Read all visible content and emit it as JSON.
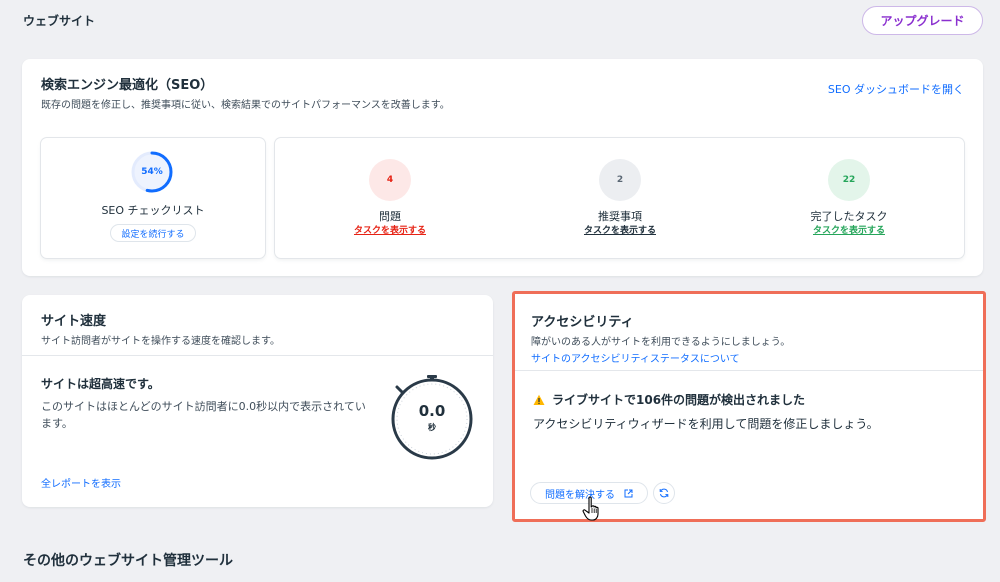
{
  "header": {
    "title": "ウェブサイト",
    "upgrade_label": "アップグレード"
  },
  "seo": {
    "title": "検索エンジン最適化（SEO）",
    "subtitle": "既存の問題を修正し、推奨事項に従い、検索結果でのサイトパフォーマンスを改善します。",
    "dashboard_link": "SEO ダッシュボードを開く",
    "checklist": {
      "progress_label": "54%",
      "progress_fraction": 0.54,
      "label": "SEO チェックリスト",
      "button": "設定を続行する"
    },
    "tasks": [
      {
        "count": "4",
        "label": "問題",
        "link": "タスクを表示する",
        "color": "#e62214",
        "bg": "#fde8e7"
      },
      {
        "count": "2",
        "label": "推奨事項",
        "link": "タスクを表示する",
        "color": "#5a6774",
        "bg": "#eceef1"
      },
      {
        "count": "22",
        "label": "完了したタスク",
        "link": "タスクを表示する",
        "color": "#25a55a",
        "bg": "#e3f5ea"
      }
    ]
  },
  "speed": {
    "title": "サイト速度",
    "subtitle": "サイト訪問者がサイトを操作する速度を確認します。",
    "headline": "サイトは超高速です。",
    "description": "このサイトはほとんどのサイト訪問者に0.0秒以内で表示されています。",
    "timer_value": "0.0",
    "timer_unit": "秒",
    "report_link": "全レポートを表示"
  },
  "accessibility": {
    "title": "アクセシビリティ",
    "subtitle": "障がいのある人がサイトを利用できるようにしましょう。",
    "status_link": "サイトのアクセシビリティステータスについて",
    "warning": "ライブサイトで106件の問題が検出されました",
    "description": "アクセシビリティウィザードを利用して問題を修正しましょう。",
    "fix_button": "問題を解決する"
  },
  "other_tools": {
    "title": "その他のウェブサイト管理ツール"
  },
  "colors": {
    "accent": "#116dff",
    "upgrade": "#8a2fcf",
    "highlight_border": "#ef6e58",
    "warning": "#ffb700"
  },
  "icons": [
    "external-link-icon",
    "refresh-icon",
    "warning-icon",
    "hand-cursor-icon",
    "stopwatch-icon"
  ]
}
